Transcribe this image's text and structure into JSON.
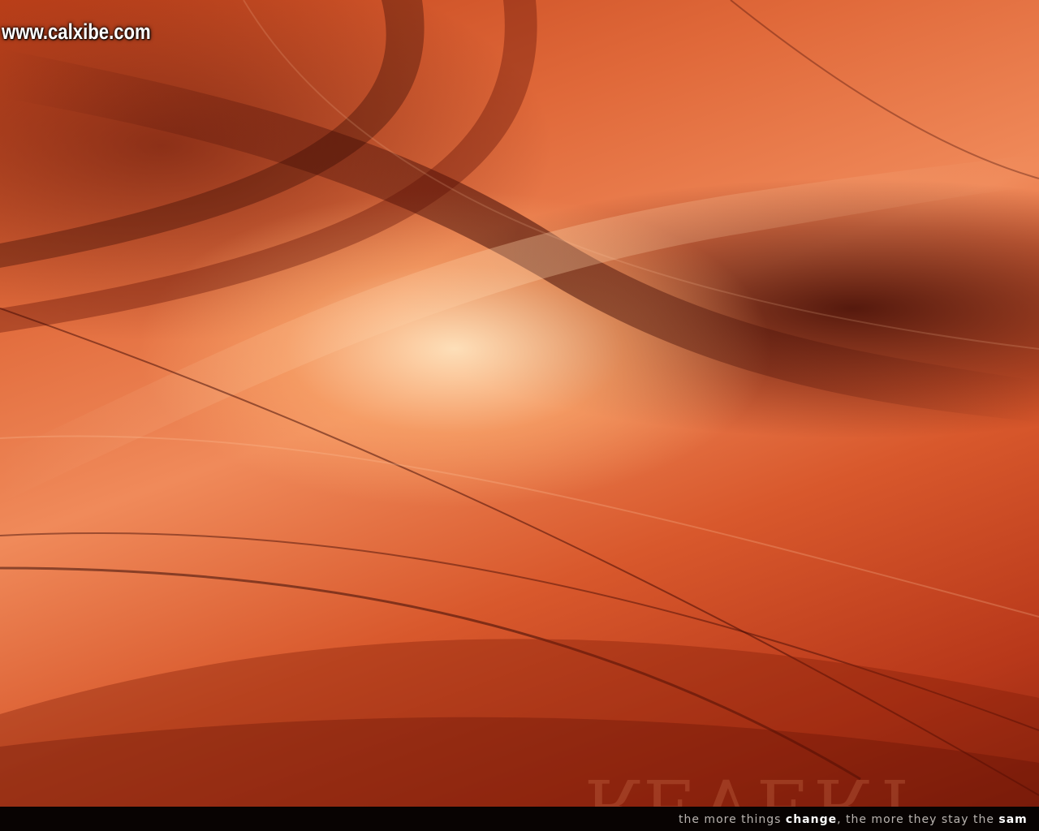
{
  "watermark": {
    "text": "www.calxibe.com"
  },
  "ghost_word": {
    "text": "REVERT"
  },
  "tagline": {
    "part1": "the more things ",
    "emphasis": "change",
    "part2": ", the more they stay the ",
    "emphasis_end": "sam"
  },
  "colors": {
    "deep_red": "#8a2410",
    "orange": "#e0693a",
    "highlight": "#ffe4be",
    "bar": "#080302"
  }
}
